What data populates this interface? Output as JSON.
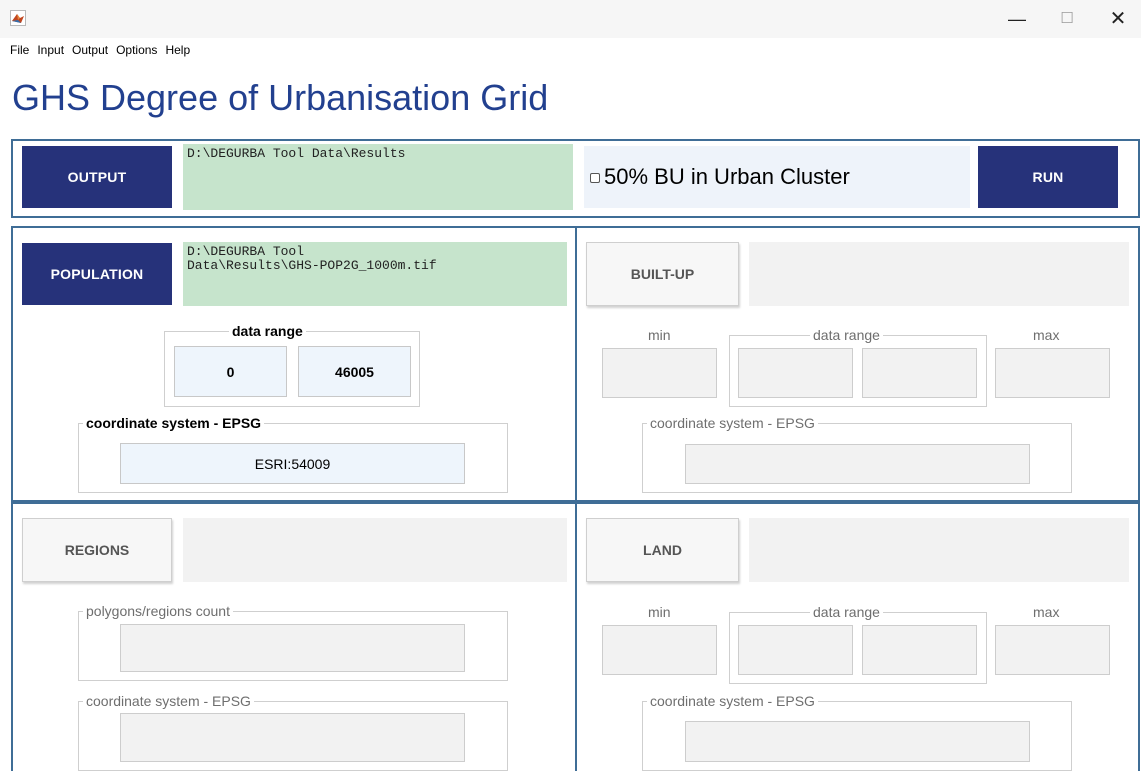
{
  "window": {
    "minimize_glyph": "—",
    "maximize_glyph": "☐",
    "close_glyph": "✕"
  },
  "menu": [
    "File",
    "Input",
    "Output",
    "Options",
    "Help"
  ],
  "title": "GHS Degree of Urbanisation Grid",
  "output": {
    "button": "OUTPUT",
    "path": "D:\\DEGURBA Tool Data\\Results",
    "bu_checkbox_label": "50% BU in Urban Cluster",
    "bu_checked": false,
    "run_button": "RUN"
  },
  "population": {
    "button": "POPULATION",
    "path": "D:\\DEGURBA Tool\nData\\Results\\GHS-POP2G_1000m.tif",
    "range_label": "data range",
    "range_min": "0",
    "range_max": "46005",
    "crs_label": "coordinate system - EPSG",
    "crs_value": "ESRI:54009"
  },
  "builtup": {
    "button": "BUILT-UP",
    "path": "",
    "min_label": "min",
    "range_label": "data range",
    "max_label": "max",
    "crs_label": "coordinate system - EPSG"
  },
  "regions": {
    "button": "REGIONS",
    "path": "",
    "count_label": "polygons/regions count",
    "crs_label": "coordinate system - EPSG"
  },
  "land": {
    "button": "LAND",
    "path": "",
    "min_label": "min",
    "range_label": "data range",
    "max_label": "max",
    "crs_label": "coordinate system - EPSG"
  },
  "colors": {
    "title": "#22408f",
    "primary_button": "#26327a",
    "path_fill": "#c6e4cc",
    "panel_border": "#3f6d96",
    "active_field": "#eef5fc",
    "inactive_field": "#f2f2f2"
  },
  "icons": {
    "app": "matlab-icon",
    "minimize": "minimize-icon",
    "maximize": "maximize-icon",
    "close": "close-icon",
    "checkbox": "checkbox-icon"
  }
}
